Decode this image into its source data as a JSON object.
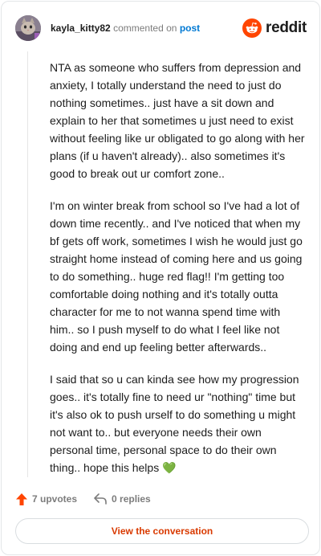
{
  "header": {
    "username": "kayla_kitty82",
    "verb": "commented on",
    "post_link": "post",
    "brand": "reddit"
  },
  "comment": {
    "paragraphs": [
      "NTA as someone who suffers from depression and anxiety, I totally understand the need to just do nothing sometimes.. just have a sit down and explain to her that sometimes u just need to exist without feeling like ur obligated to go along with her plans (if u haven't already).. also sometimes it's good to break out ur comfort zone..",
      "I'm on winter break from school so I've had a lot of down time recently.. and I've noticed that when my bf gets off work, sometimes I wish he would just go straight home instead of coming here and us going to do something.. huge red flag!! I'm getting too comfortable doing nothing and it's totally outta character for me to not wanna spend time with him.. so I push myself to do what I feel like not doing and end up feeling better afterwards..",
      "I said that so u can kinda see how my progression goes.. it's totally fine to need ur \"nothing\" time but it's also ok to push urself to do something u might not want to.. but everyone needs their own personal time, personal space to do their own thing.. hope this helps"
    ],
    "emoji": "💚"
  },
  "actions": {
    "upvotes": "7 upvotes",
    "replies": "0 replies"
  },
  "view_button": "View the conversation",
  "colors": {
    "brand_orange": "#ff4500",
    "link_blue": "#0079d3",
    "button_text": "#d93a00",
    "muted": "#7c7c7c"
  },
  "icons": {
    "avatar": "cat-avatar",
    "logo": "reddit-snoo-icon",
    "upvote": "upvote-arrow-icon",
    "reply": "reply-arrow-icon"
  }
}
